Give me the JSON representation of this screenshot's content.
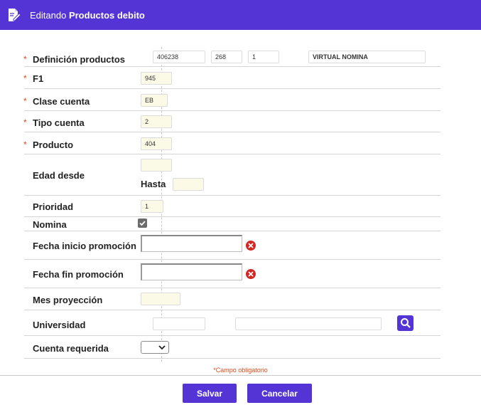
{
  "header": {
    "prefix": "Editando",
    "title": "Productos debito",
    "icon": "edit-document-icon"
  },
  "colors": {
    "accent": "#5434d4",
    "required": "#e04a1a",
    "input_bg": "#fafae6",
    "clear": "#d32727"
  },
  "required_mark": "*",
  "fields": {
    "definicion": {
      "label": "Definición productos",
      "values": [
        "406238",
        "268",
        "1",
        "VIRTUAL NOMINA"
      ]
    },
    "f1": {
      "label": "F1",
      "value": "945"
    },
    "clase_cuenta": {
      "label": "Clase cuenta",
      "value": "EB"
    },
    "tipo_cuenta": {
      "label": "Tipo cuenta",
      "value": "2"
    },
    "producto": {
      "label": "Producto",
      "value": "404"
    },
    "edad": {
      "label": "Edad desde",
      "desde": "",
      "hasta_label": "Hasta",
      "hasta": ""
    },
    "prioridad": {
      "label": "Prioridad",
      "value": "1"
    },
    "nomina": {
      "label": "Nomina",
      "checked": true
    },
    "fecha_inicio": {
      "label": "Fecha inicio promoción",
      "value": ""
    },
    "fecha_fin": {
      "label": "Fecha fin promoción",
      "value": ""
    },
    "mes_proyeccion": {
      "label": "Mes proyección",
      "value": ""
    },
    "universidad": {
      "label": "Universidad",
      "code": "",
      "name": ""
    },
    "cuenta_requerida": {
      "label": "Cuenta requerida",
      "value": ""
    }
  },
  "footer": {
    "required_note": "Campo obligatorio",
    "save_label": "Salvar",
    "cancel_label": "Cancelar"
  }
}
